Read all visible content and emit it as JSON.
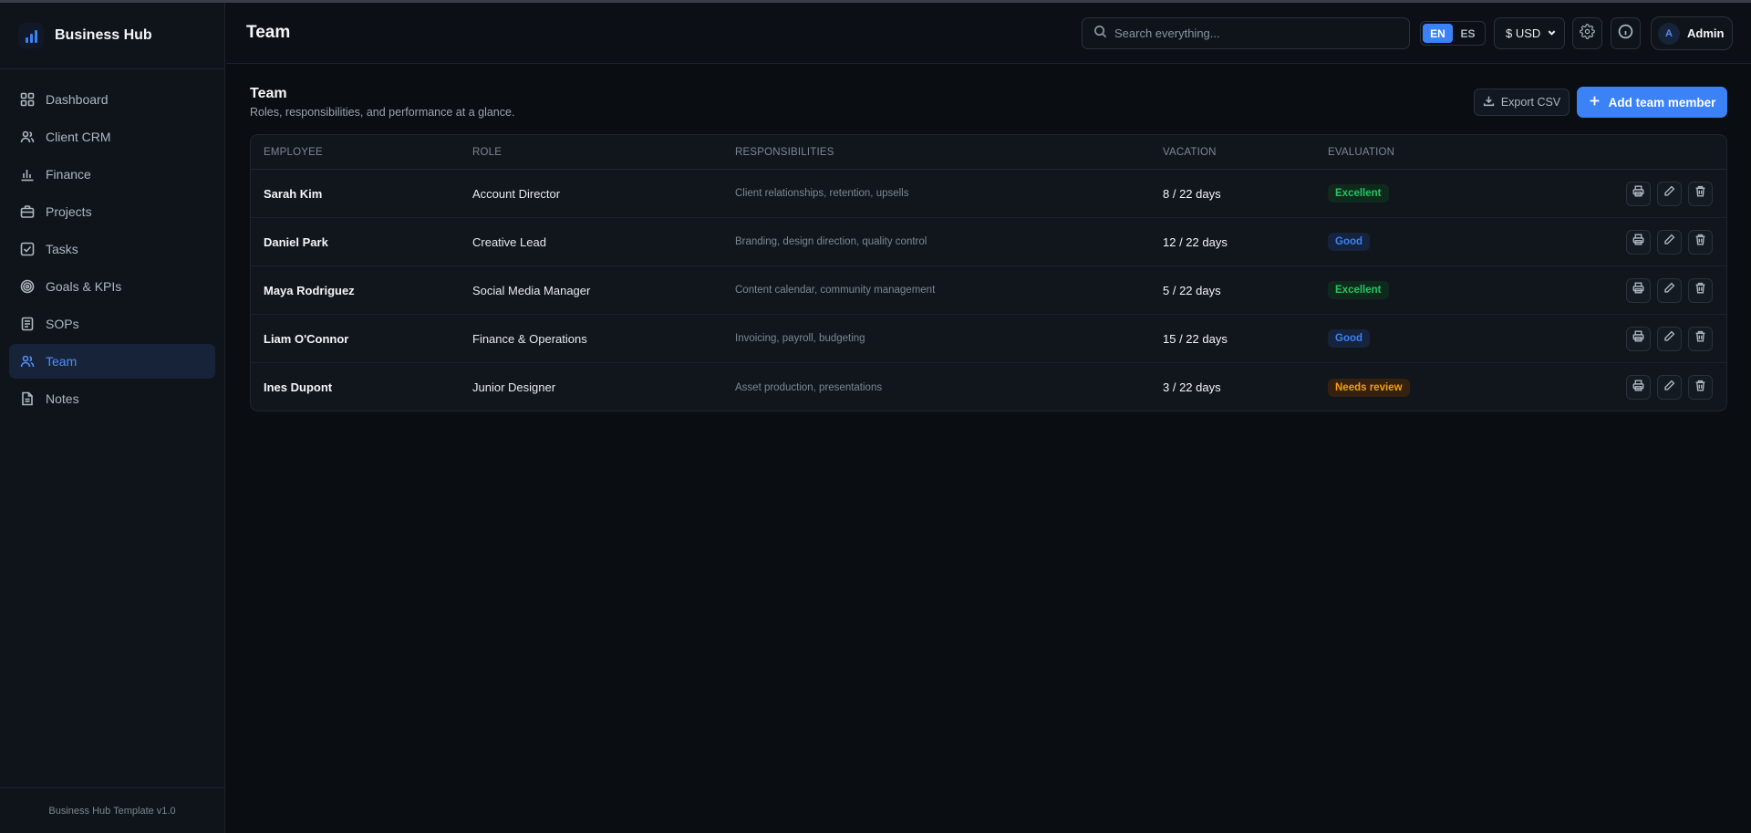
{
  "app": {
    "name": "Business Hub",
    "footer": "Business Hub Template v1.0"
  },
  "sidebar": {
    "items": [
      {
        "label": "Dashboard",
        "icon": "grid-icon"
      },
      {
        "label": "Client CRM",
        "icon": "users-icon"
      },
      {
        "label": "Finance",
        "icon": "bar-chart-icon"
      },
      {
        "label": "Projects",
        "icon": "briefcase-icon"
      },
      {
        "label": "Tasks",
        "icon": "checkbox-icon"
      },
      {
        "label": "Goals & KPIs",
        "icon": "target-icon"
      },
      {
        "label": "SOPs",
        "icon": "clipboard-icon"
      },
      {
        "label": "Team",
        "icon": "team-icon",
        "active": true
      },
      {
        "label": "Notes",
        "icon": "document-icon"
      }
    ]
  },
  "header": {
    "title": "Team",
    "search_placeholder": "Search everything...",
    "lang": {
      "en": "EN",
      "es": "ES",
      "selected": "EN"
    },
    "currency": "$ USD",
    "user": {
      "initial": "A",
      "name": "Admin"
    }
  },
  "page": {
    "title": "Team",
    "subtitle": "Roles, responsibilities, and performance at a glance.",
    "export_label": "Export CSV",
    "add_label": "Add team member"
  },
  "table": {
    "headers": [
      "EMPLOYEE",
      "ROLE",
      "RESPONSIBILITIES",
      "VACATION",
      "EVALUATION"
    ],
    "rows": [
      {
        "employee": "Sarah Kim",
        "role": "Account Director",
        "responsibilities": "Client relationships, retention, upsells",
        "vacation": "8 / 22 days",
        "evaluation": "Excellent",
        "eval_kind": "excellent"
      },
      {
        "employee": "Daniel Park",
        "role": "Creative Lead",
        "responsibilities": "Branding, design direction, quality control",
        "vacation": "12 / 22 days",
        "evaluation": "Good",
        "eval_kind": "good"
      },
      {
        "employee": "Maya Rodriguez",
        "role": "Social Media Manager",
        "responsibilities": "Content calendar, community management",
        "vacation": "5 / 22 days",
        "evaluation": "Excellent",
        "eval_kind": "excellent"
      },
      {
        "employee": "Liam O'Connor",
        "role": "Finance & Operations",
        "responsibilities": "Invoicing, payroll, budgeting",
        "vacation": "15 / 22 days",
        "evaluation": "Good",
        "eval_kind": "good"
      },
      {
        "employee": "Ines Dupont",
        "role": "Junior Designer",
        "responsibilities": "Asset production, presentations",
        "vacation": "3 / 22 days",
        "evaluation": "Needs review",
        "eval_kind": "review"
      }
    ]
  },
  "colors": {
    "accent": "#3b82f6",
    "excellent": "#22c55e",
    "good": "#3b82f6",
    "review": "#f59e0b"
  }
}
